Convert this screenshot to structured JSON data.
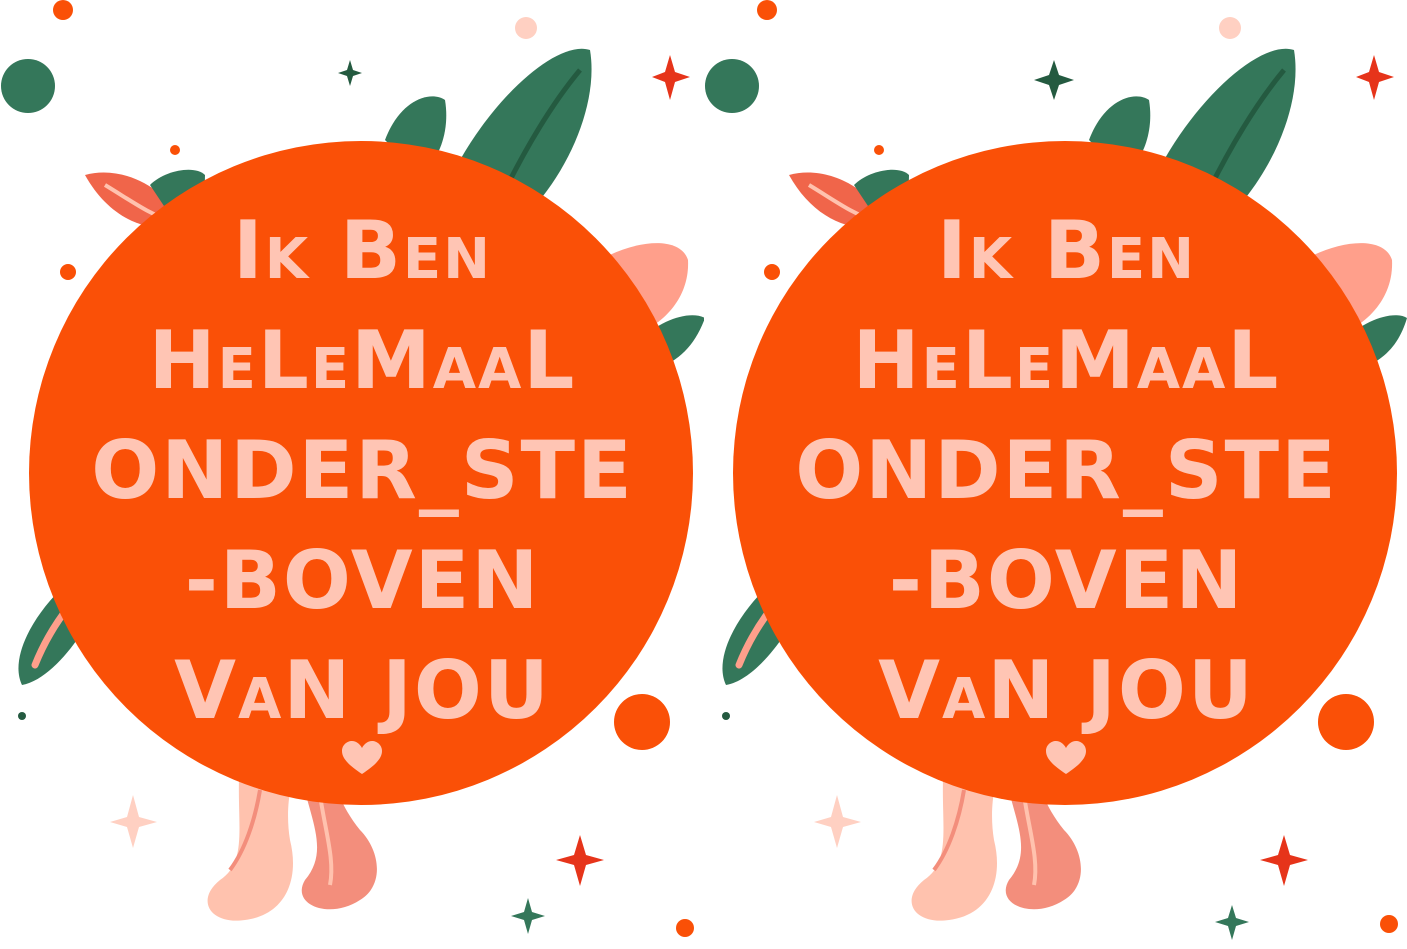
{
  "colors": {
    "orange": "#FA5007",
    "text": "#FFC5B4",
    "leaf_dark": "#34775A",
    "leaf_vein": "#245A40",
    "leaf_pink": "#FF9F8B",
    "leaf_coral": "#F0654A",
    "root_pink": "#FFC2AE",
    "root_coral": "#F38E7C",
    "sparkle_red": "#E6341A",
    "dot_pink": "#FFD0C2"
  },
  "cards": [
    {
      "lines": [
        "Ik Ben",
        "HeLeMaaL",
        "ONDER_STE",
        "-BOVEN",
        "VaN JOU"
      ],
      "icon": "heart-icon"
    },
    {
      "lines": [
        "Ik Ben",
        "HeLeMaaL",
        "ONDER_STE",
        "-BOVEN",
        "VaN JOU"
      ],
      "icon": "heart-icon"
    }
  ]
}
